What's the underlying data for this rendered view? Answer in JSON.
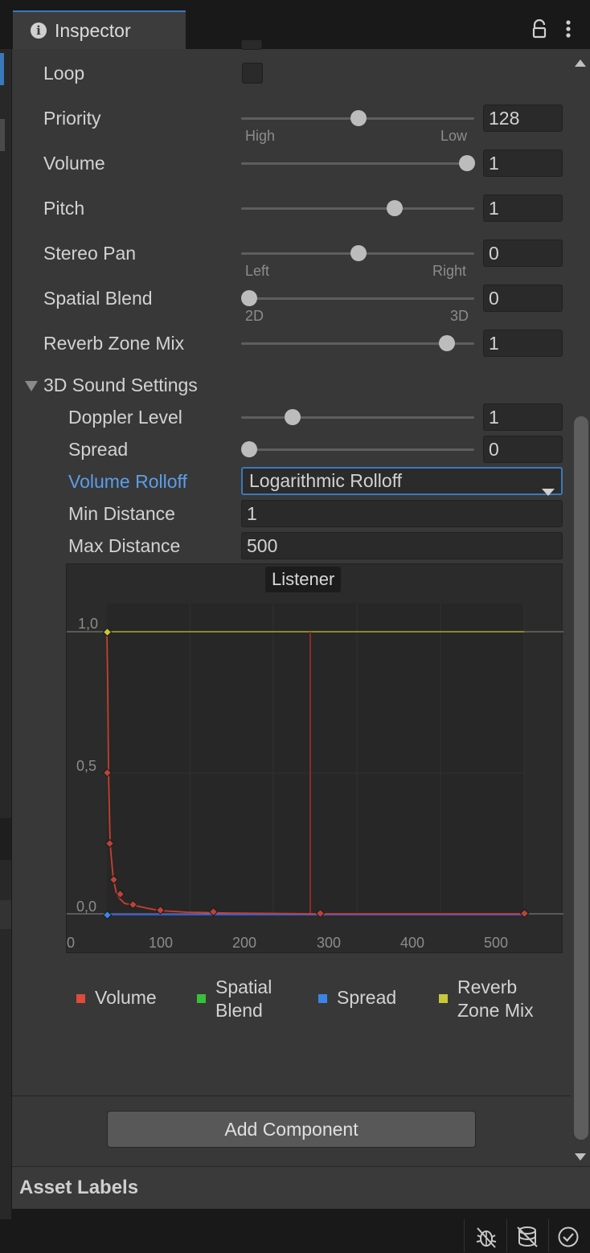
{
  "tab": {
    "title": "Inspector"
  },
  "fields": {
    "loop": {
      "label": "Loop"
    },
    "priority": {
      "label": "Priority",
      "value": "128",
      "min_label": "High",
      "max_label": "Low",
      "slider": 0.5
    },
    "volume": {
      "label": "Volume",
      "value": "1",
      "slider": 1.0
    },
    "pitch": {
      "label": "Pitch",
      "value": "1",
      "slider": 0.667
    },
    "stereo_pan": {
      "label": "Stereo Pan",
      "value": "0",
      "min_label": "Left",
      "max_label": "Right",
      "slider": 0.5
    },
    "spatial_blend": {
      "label": "Spatial Blend",
      "value": "0",
      "min_label": "2D",
      "max_label": "3D",
      "slider": 0.0
    },
    "reverb_zone_mix": {
      "label": "Reverb Zone Mix",
      "value": "1",
      "slider": 0.909
    }
  },
  "sound3d": {
    "title": "3D Sound Settings",
    "doppler": {
      "label": "Doppler Level",
      "value": "1",
      "slider": 0.2
    },
    "spread": {
      "label": "Spread",
      "value": "0",
      "slider": 0.0
    },
    "rolloff": {
      "label": "Volume Rolloff",
      "value": "Logarithmic Rolloff"
    },
    "min_distance": {
      "label": "Min Distance",
      "value": "1"
    },
    "max_distance": {
      "label": "Max Distance",
      "value": "500"
    }
  },
  "graph": {
    "listener_label": "Listener",
    "y_ticks": [
      "1,0",
      "0,5",
      "0,0"
    ],
    "x_ticks": [
      "0",
      "100",
      "200",
      "300",
      "400",
      "500"
    ],
    "legend": [
      {
        "label": "Volume",
        "color": "#e04a3a"
      },
      {
        "label": "Spatial Blend",
        "color": "#38c038"
      },
      {
        "label": "Spread",
        "color": "#3a86e8"
      },
      {
        "label": "Reverb Zone Mix",
        "color": "#c8c83a"
      }
    ]
  },
  "add_component": "Add Component",
  "asset_labels": "Asset Labels",
  "colors": {
    "accent": "#3a79bb",
    "rolloff_label": "#5b9ee8"
  }
}
